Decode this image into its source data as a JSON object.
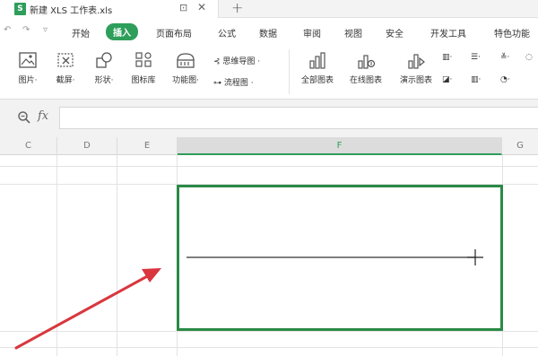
{
  "tab": {
    "file_icon_letter": "S",
    "title": "新建 XLS 工作表.xls",
    "new_tab_glyph": "+"
  },
  "quick_access": {
    "undo": "↶",
    "redo": "↷",
    "more": "▿"
  },
  "menu": {
    "items": [
      "开始",
      "插入",
      "页面布局",
      "公式",
      "数据",
      "审阅",
      "视图",
      "安全",
      "开发工具",
      "特色功能"
    ],
    "active": "插入"
  },
  "ribbon": {
    "big": [
      {
        "label": "图片·",
        "icon": "picture-icon"
      },
      {
        "label": "截屏·",
        "icon": "screenshot-icon"
      },
      {
        "label": "形状·",
        "icon": "shapes-icon"
      },
      {
        "label": "图标库",
        "icon": "icon-library-icon"
      },
      {
        "label": "功能图·",
        "icon": "function-chart-icon"
      }
    ],
    "small_left": [
      {
        "label": "思维导图 ·",
        "icon": "mindmap-icon"
      },
      {
        "label": "流程图 ·",
        "icon": "flowchart-icon"
      }
    ],
    "charts": [
      {
        "label": "全部图表",
        "icon": "all-charts-icon"
      },
      {
        "label": "在线图表",
        "icon": "online-charts-icon"
      },
      {
        "label": "演示图表",
        "icon": "demo-charts-icon"
      }
    ],
    "chart_type_dropdowns": [
      "column-chart-icon",
      "bar-chart-icon",
      "line-chart-icon",
      "more-chart-icon",
      "area-chart-icon",
      "stock-chart-icon",
      "pie-chart-icon"
    ]
  },
  "formula_bar": {
    "fx_label": "fx",
    "value": ""
  },
  "columns": [
    "C",
    "D",
    "E",
    "F",
    "G"
  ],
  "selected_column": "F",
  "colors": {
    "accent": "#2e9e5b",
    "shape_border": "#2a8a46",
    "arrow": "#d9363e"
  }
}
